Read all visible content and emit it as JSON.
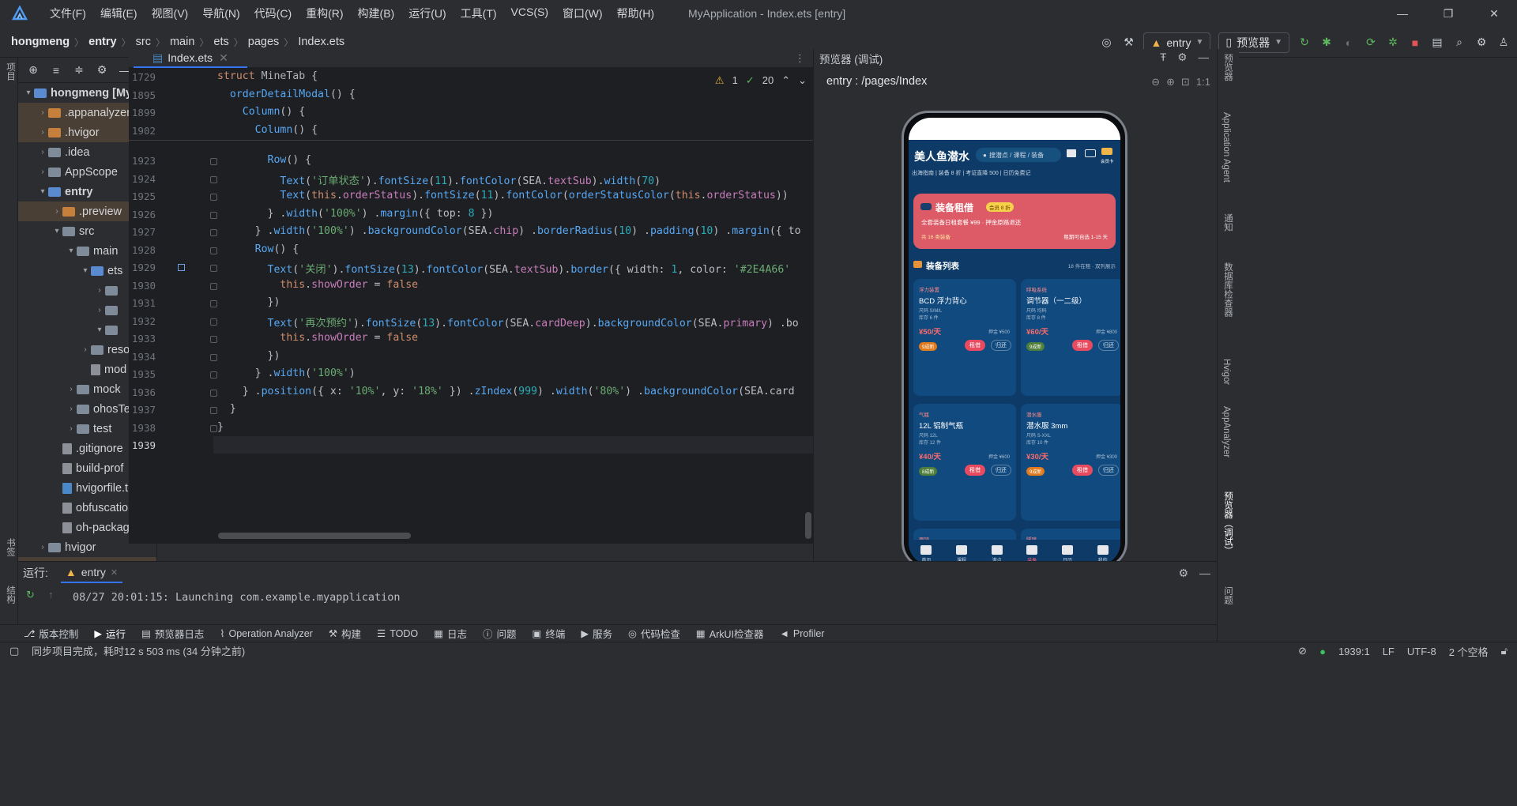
{
  "titlebar": {
    "menu": [
      "文件(F)",
      "编辑(E)",
      "视图(V)",
      "导航(N)",
      "代码(C)",
      "重构(R)",
      "构建(B)",
      "运行(U)",
      "工具(T)",
      "VCS(S)",
      "窗口(W)",
      "帮助(H)"
    ],
    "window_title": "MyApplication - Index.ets [entry]"
  },
  "breadcrumb": {
    "items": [
      "hongmeng",
      "entry",
      "src",
      "main",
      "ets",
      "pages",
      "Index.ets"
    ]
  },
  "toolbar": {
    "module_combo": "entry",
    "device_combo": "预览器"
  },
  "project_tree": {
    "rows": [
      {
        "label": "hongmeng [My",
        "indent": 0,
        "arrow": "▾",
        "kind": "folder-blue",
        "bold": true
      },
      {
        "label": ".appanalyzer",
        "indent": 1,
        "arrow": "›",
        "kind": "folder-orange",
        "mod": true
      },
      {
        "label": ".hvigor",
        "indent": 1,
        "arrow": "›",
        "kind": "folder-orange",
        "mod": true
      },
      {
        "label": ".idea",
        "indent": 1,
        "arrow": "›",
        "kind": "folder"
      },
      {
        "label": "AppScope",
        "indent": 1,
        "arrow": "›",
        "kind": "folder"
      },
      {
        "label": "entry",
        "indent": 1,
        "arrow": "▾",
        "kind": "folder-blue",
        "bold": true
      },
      {
        "label": ".preview",
        "indent": 2,
        "arrow": "›",
        "kind": "folder-orange",
        "mod": true
      },
      {
        "label": "src",
        "indent": 2,
        "arrow": "▾",
        "kind": "folder"
      },
      {
        "label": "main",
        "indent": 3,
        "arrow": "▾",
        "kind": "folder"
      },
      {
        "label": "ets",
        "indent": 4,
        "arrow": "▾",
        "kind": "folder-blue"
      },
      {
        "label": "",
        "indent": 5,
        "arrow": "›",
        "kind": "folder"
      },
      {
        "label": "",
        "indent": 5,
        "arrow": "›",
        "kind": "folder"
      },
      {
        "label": "",
        "indent": 5,
        "arrow": "▾",
        "kind": "folder"
      },
      {
        "label": "reso",
        "indent": 4,
        "arrow": "›",
        "kind": "folder"
      },
      {
        "label": "mod",
        "indent": 4,
        "arrow": "",
        "kind": "file"
      },
      {
        "label": "mock",
        "indent": 3,
        "arrow": "›",
        "kind": "folder"
      },
      {
        "label": "ohosTe",
        "indent": 3,
        "arrow": "›",
        "kind": "folder"
      },
      {
        "label": "test",
        "indent": 3,
        "arrow": "›",
        "kind": "folder"
      },
      {
        "label": ".gitignore",
        "indent": 2,
        "arrow": "",
        "kind": "file"
      },
      {
        "label": "build-prof",
        "indent": 2,
        "arrow": "",
        "kind": "file"
      },
      {
        "label": "hvigorfile.t",
        "indent": 2,
        "arrow": "",
        "kind": "file-ts"
      },
      {
        "label": "obfuscatio",
        "indent": 2,
        "arrow": "",
        "kind": "file"
      },
      {
        "label": "oh-packag",
        "indent": 2,
        "arrow": "",
        "kind": "file"
      },
      {
        "label": "hvigor",
        "indent": 1,
        "arrow": "›",
        "kind": "folder"
      },
      {
        "label": "oh_modules",
        "indent": 1,
        "arrow": "›",
        "kind": "folder-orange",
        "mod": true
      },
      {
        "label": ".gitignore",
        "indent": 1,
        "arrow": "",
        "kind": "file"
      },
      {
        "label": "build-profile.",
        "indent": 1,
        "arrow": "",
        "kind": "file"
      },
      {
        "label": "code-linter.js",
        "indent": 1,
        "arrow": "",
        "kind": "file"
      },
      {
        "label": "hvigorfile.ts",
        "indent": 1,
        "arrow": "",
        "kind": "file-ts"
      }
    ]
  },
  "editor": {
    "tab_label": "Index.ets",
    "inspections": {
      "warnings": "1",
      "ok": "20"
    },
    "sticky": [
      {
        "ln": "1729",
        "html": "<span class=\"kw\">struct</span> <span class=\"ty2\">MineTab</span> {"
      },
      {
        "ln": "1895",
        "html": "  <span class=\"fn\">orderDetailModal</span>() {"
      },
      {
        "ln": "1899",
        "html": "    <span class=\"fn\">Column</span>() {"
      },
      {
        "ln": "1902",
        "html": "      <span class=\"fn\">Column</span>() {"
      }
    ],
    "lines": [
      {
        "ln": "1923",
        "html": "        <span class=\"fn\">Row</span>() {"
      },
      {
        "ln": "1924",
        "html": "          <span class=\"fn\">Text</span>(<span class=\"str\">'订单状态'</span>).<span class=\"fn\">fontSize</span>(<span class=\"num\">11</span>).<span class=\"fn\">fontColor</span>(SEA.<span class=\"prop\">textSub</span>).<span class=\"fn\">width</span>(<span class=\"num\">70</span>)"
      },
      {
        "ln": "1925",
        "html": "          <span class=\"fn\">Text</span>(<span class=\"kw\">this</span>.<span class=\"prop\">orderStatus</span>).<span class=\"fn\">fontSize</span>(<span class=\"num\">11</span>).<span class=\"fn\">fontColor</span>(<span class=\"fn\">orderStatusColor</span>(<span class=\"kw\">this</span>.<span class=\"prop\">orderStatus</span>))"
      },
      {
        "ln": "1926",
        "html": "        } .<span class=\"fn\">width</span>(<span class=\"str\">'100%'</span>) .<span class=\"fn\">margin</span>({ top: <span class=\"num\">8</span> })"
      },
      {
        "ln": "1927",
        "html": "      } .<span class=\"fn\">width</span>(<span class=\"str\">'100%'</span>) .<span class=\"fn\">backgroundColor</span>(SEA.<span class=\"prop\">chip</span>) .<span class=\"fn\">borderRadius</span>(<span class=\"num\">10</span>) .<span class=\"fn\">padding</span>(<span class=\"num\">10</span>) .<span class=\"fn\">margin</span>({ to"
      },
      {
        "ln": "1928",
        "html": "      <span class=\"fn\">Row</span>() {"
      },
      {
        "ln": "1929",
        "html": "        <span class=\"fn\">Text</span>(<span class=\"str\">'关闭'</span>).<span class=\"fn\">fontSize</span>(<span class=\"num\">13</span>).<span class=\"fn\">fontColor</span>(SEA.<span class=\"prop\">textSub</span>).<span class=\"fn\">border</span>({ width: <span class=\"num\">1</span>, color: <span class=\"str\">'#2E4A66'</span>"
      },
      {
        "ln": "1930",
        "html": "          <span class=\"kw\">this</span>.<span class=\"prop\">showOrder</span> = <span class=\"kw\">false</span>"
      },
      {
        "ln": "1931",
        "html": "        })"
      },
      {
        "ln": "1932",
        "html": "        <span class=\"fn\">Text</span>(<span class=\"str\">'再次预约'</span>).<span class=\"fn\">fontSize</span>(<span class=\"num\">13</span>).<span class=\"fn\">fontColor</span>(SEA.<span class=\"prop\">cardDeep</span>).<span class=\"fn\">backgroundColor</span>(SEA.<span class=\"prop\">primary</span>) .bo"
      },
      {
        "ln": "1933",
        "html": "          <span class=\"kw\">this</span>.<span class=\"prop\">showOrder</span> = <span class=\"kw\">false</span>"
      },
      {
        "ln": "1934",
        "html": "        })"
      },
      {
        "ln": "1935",
        "html": "      } .<span class=\"fn\">width</span>(<span class=\"str\">'100%'</span>)"
      },
      {
        "ln": "1936",
        "html": "    } .<span class=\"fn\">position</span>({ x: <span class=\"str\">'10%'</span>, y: <span class=\"str\">'18%'</span> }) .<span class=\"fn\">zIndex</span>(<span class=\"num\">999</span>) .<span class=\"fn\">width</span>(<span class=\"str\">'80%'</span>) .<span class=\"fn\">backgroundColor</span>(SEA.card"
      },
      {
        "ln": "1937",
        "html": "  }"
      },
      {
        "ln": "1938",
        "html": "}"
      },
      {
        "ln": "1939",
        "html": ""
      }
    ]
  },
  "preview": {
    "title": "预览器 (调试)",
    "route": "entry : /pages/Index",
    "app": {
      "brand": "美人鱼潜水",
      "search_placeholder": "搜潜点 / 课程 / 装备",
      "member_label": "会员卡",
      "chips": "出海指南  |  装备 8 折  |  考证直降 500  |  日历免费记",
      "banner": {
        "title": "装备租借",
        "tag": "会员 8 折",
        "line1": "全套装备日租套餐 ¥99 · 押金原路退还",
        "line2": "共 16 类装备",
        "line3": "租期可自选 1-15 天"
      },
      "list_title": "装备列表",
      "list_meta": "18 件在租 · 双列展示",
      "cards": [
        {
          "cat": "浮力装置",
          "name": "BCD 浮力背心",
          "m1": "尺码 S/M/L",
          "m2": "库存 6 件",
          "price": "¥50/天",
          "deposit": "押金 ¥500",
          "cond": "9成新",
          "cond_green": false,
          "rent": "租借",
          "ret": "归还"
        },
        {
          "cat": "呼吸系统",
          "name": "调节器（一二级）",
          "m1": "尺码 均码",
          "m2": "库存 8 件",
          "price": "¥60/天",
          "deposit": "押金 ¥800",
          "cond": "9成新",
          "cond_green": true,
          "rent": "租借",
          "ret": "归还"
        },
        {
          "cat": "气瓶",
          "name": "12L 铝制气瓶",
          "m1": "尺码 12L",
          "m2": "库存 12 件",
          "price": "¥40/天",
          "deposit": "押金 ¥600",
          "cond": "8成新",
          "cond_green": true,
          "rent": "租借",
          "ret": "归还"
        },
        {
          "cat": "潜水服",
          "name": "潜水服 3mm",
          "m1": "尺码 S-XXL",
          "m2": "库存 10 件",
          "price": "¥30/天",
          "deposit": "押金 ¥300",
          "cond": "9成新",
          "cond_green": false,
          "rent": "租借",
          "ret": "归还"
        },
        {
          "cat": "面镜",
          "name": "",
          "m1": "",
          "m2": "",
          "price": "",
          "deposit": "",
          "cond": "",
          "cond_green": false,
          "rent": "",
          "ret": ""
        },
        {
          "cat": "脚蹼",
          "name": "",
          "m1": "",
          "m2": "",
          "price": "",
          "deposit": "",
          "cond": "",
          "cond_green": false,
          "rent": "",
          "ret": ""
        }
      ],
      "tabs": [
        "首页",
        "课程",
        "潜点",
        "装备",
        "日历",
        "我的"
      ],
      "active_tab": "装备"
    }
  },
  "right_labels": [
    "预览器",
    "Application Agent",
    "通知",
    "数据库检查器",
    "Hvigor",
    "AppAnalyzer",
    "预览器（调试）",
    "问题"
  ],
  "left_labels": [
    "项目",
    "书签",
    "结构"
  ],
  "run_panel": {
    "label": "运行:",
    "tab": "entry",
    "output": "08/27 20:01:15: Launching com.example.myapplication"
  },
  "tool_windows": [
    "版本控制",
    "运行",
    "预览器日志",
    "Operation Analyzer",
    "构建",
    "TODO",
    "日志",
    "问题",
    "终端",
    "服务",
    "代码检查",
    "ArkUI检查器",
    "Profiler"
  ],
  "status": {
    "message": "同步项目完成，耗时12 s 503 ms (34 分钟之前)",
    "position": "1939:1",
    "line_sep": "LF",
    "encoding": "UTF-8",
    "indent": "2 个空格"
  }
}
